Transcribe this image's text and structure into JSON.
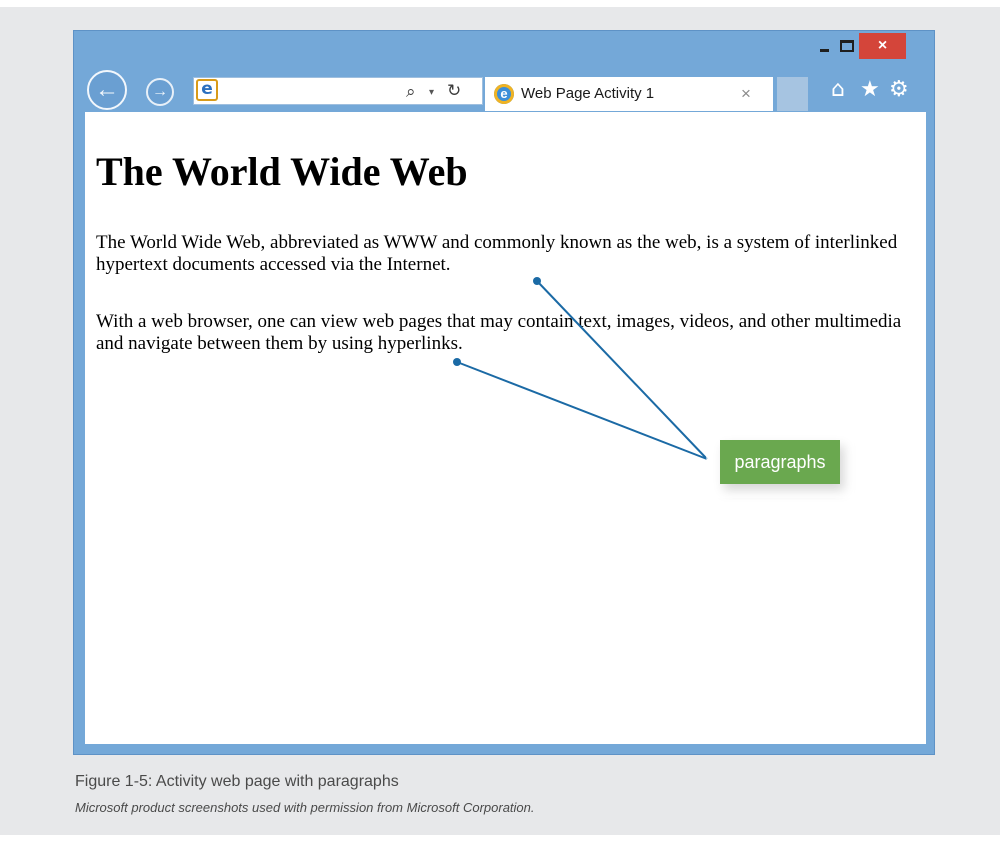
{
  "browser": {
    "window_controls": {
      "close_glyph": "×"
    },
    "nav": {
      "back_glyph": "←",
      "forward_glyph": "→"
    },
    "address_bar": {
      "url": "",
      "search_glyph": "⌕",
      "dropdown_glyph": "▾",
      "refresh_glyph": "↻"
    },
    "tab": {
      "title": "Web Page Activity 1",
      "close_glyph": "×"
    },
    "toolbar_icons": [
      "home-icon",
      "star-icon",
      "gear-icon"
    ],
    "toolbar_glyphs": {
      "home": "⌂",
      "star": "★",
      "gear": "⚙"
    }
  },
  "page": {
    "heading": "The World Wide Web",
    "paragraphs": [
      "The World Wide Web, abbreviated as WWW and commonly known as the web, is a system of interlinked hypertext documents accessed via the Internet.",
      "With a web browser, one can view web pages that may contain text, images, videos, and other multimedia and navigate between them by using hyperlinks."
    ]
  },
  "callout": {
    "label": "paragraphs",
    "color": "#6aa84f",
    "line_color": "#1b6aa5"
  },
  "figure": {
    "caption": "Figure 1-5: Activity web page with paragraphs",
    "credit": "Microsoft product screenshots used with permission from Microsoft Corporation."
  },
  "colors": {
    "frame": "#74a8d8",
    "close_button": "#d4453a",
    "panel_background": "#e7e8ea"
  }
}
